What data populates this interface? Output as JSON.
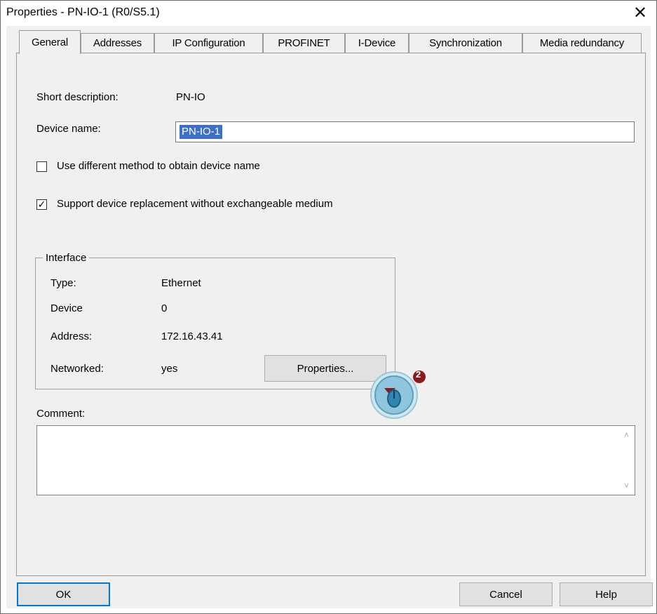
{
  "window": {
    "title": "Properties - PN-IO-1 (R0/S5.1)",
    "close_glyph": "✕"
  },
  "tabs": [
    {
      "label": "General",
      "active": true
    },
    {
      "label": "Addresses",
      "active": false
    },
    {
      "label": "IP Configuration",
      "active": false
    },
    {
      "label": "PROFINET",
      "active": false
    },
    {
      "label": "I-Device",
      "active": false
    },
    {
      "label": "Synchronization",
      "active": false
    },
    {
      "label": "Media redundancy",
      "active": false
    }
  ],
  "general": {
    "short_description_label": "Short description:",
    "short_description_value": "PN-IO",
    "device_name_label": "Device name:",
    "device_name_value": "PN-IO-1",
    "use_different_method_label": "Use different method to obtain device name",
    "use_different_method_checked": false,
    "support_replacement_label": "Support device replacement without exchangeable medium",
    "support_replacement_checked": true,
    "check_glyph": "✓"
  },
  "interface": {
    "group_title": "Interface",
    "type_label": "Type:",
    "type_value": "Ethernet",
    "device_label": "Device",
    "device_value": "0",
    "address_label": "Address:",
    "address_value": "172.16.43.41",
    "networked_label": "Networked:",
    "networked_value": "yes",
    "properties_button": "Properties..."
  },
  "comment": {
    "label": "Comment:",
    "value": "",
    "scroll_up": "˄",
    "scroll_down": "˅"
  },
  "footer": {
    "ok": "OK",
    "cancel": "Cancel",
    "help": "Help"
  },
  "annotation": {
    "step_number": "2",
    "icon": "mouse-click-icon",
    "accent_color": "#8b1a1a",
    "bubble_color": "#6fb6d6"
  }
}
